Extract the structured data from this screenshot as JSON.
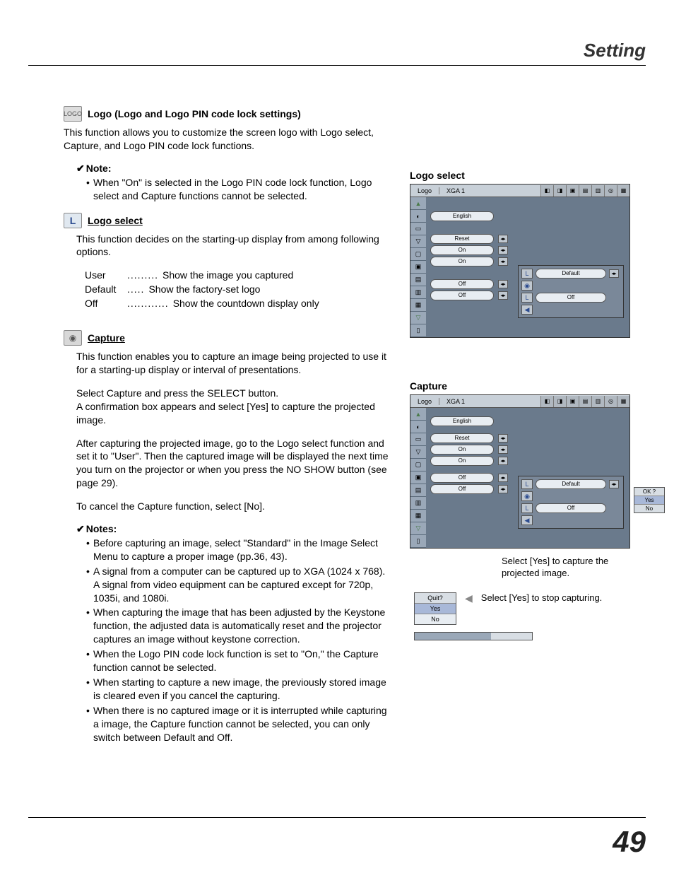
{
  "header": {
    "title": "Setting"
  },
  "page_number": "49",
  "logo_section": {
    "icon": "LOGO",
    "title": "Logo (Logo and Logo PIN code lock settings)",
    "intro": "This function allows you to customize the screen logo with Logo select, Capture, and Logo PIN code lock functions.",
    "note_label": "Note:",
    "note_text": "When \"On\" is selected in the Logo PIN code lock function, Logo select and Capture functions cannot be selected."
  },
  "logo_select": {
    "title": "Logo select",
    "intro": "This function decides on the starting-up display from among following options.",
    "options": [
      {
        "k": "User",
        "dots": ".........",
        "v": "Show the image you captured"
      },
      {
        "k": "Default",
        "dots": ".....",
        "v": "Show the factory-set logo"
      },
      {
        "k": "Off",
        "dots": "............",
        "v": "Show the countdown display only"
      }
    ]
  },
  "capture": {
    "title": "Capture",
    "p1": "This function enables you to capture an image being projected to use it for a starting-up display or interval of presentations.",
    "p2a": "Select Capture and press the SELECT button.",
    "p2b": "A confirmation box appears and select [Yes] to capture the projected image.",
    "p3": "After capturing the projected image, go to the Logo select function and set it to \"User\". Then the captured image will be displayed the next time you turn on the projector or when you press the NO SHOW button (see page 29).",
    "p4": "To cancel the Capture function, select [No].",
    "notes_label": "Notes:",
    "notes": [
      "Before capturing an image, select \"Standard\" in the Image Select Menu to capture a proper image (pp.36, 43).",
      "A signal from a computer can be captured up to XGA (1024 x 768). A signal from video equipment can be captured except for 720p, 1035i, and 1080i.",
      "When capturing the image that has been adjusted by the Keystone function, the adjusted data is automatically reset and the projector captures an image without keystone correction.",
      "When the Logo PIN code lock function is set to \"On,\" the Capture function cannot be selected.",
      "When starting to capture a new image, the previously stored image is cleared even if you cancel the capturing.",
      "When there is no captured image or it is interrupted while capturing a image, the Capture function cannot be selected, you can only switch between Default and Off."
    ]
  },
  "right": {
    "logo_select_title": "Logo select",
    "capture_title": "Capture",
    "caption_capture": "Select [Yes] to capture the projected image.",
    "caption_quit": "Select [Yes] to stop capturing.",
    "osd": {
      "menu_label": "Logo",
      "mode": "XGA 1",
      "rows": [
        "English",
        "Reset",
        "On",
        "On",
        "Off",
        "Off"
      ],
      "popup": {
        "default": "Default",
        "off": "Off"
      },
      "confirm": {
        "title": "OK ?",
        "yes": "Yes",
        "no": "No"
      },
      "quit": {
        "title": "Quit?",
        "yes": "Yes",
        "no": "No"
      }
    }
  }
}
